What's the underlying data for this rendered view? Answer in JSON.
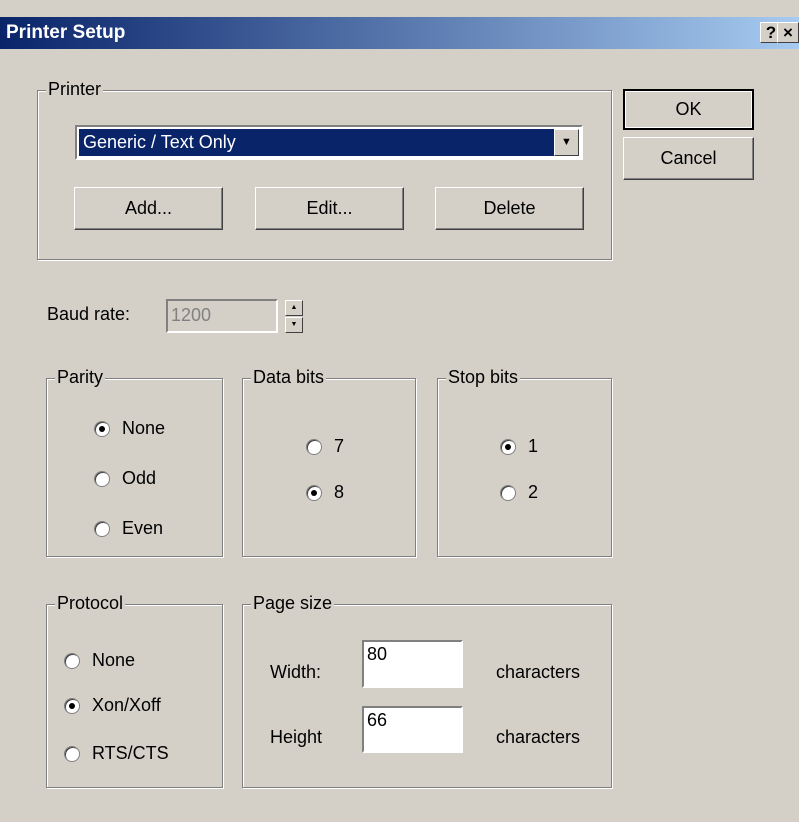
{
  "window": {
    "title": "Printer Setup",
    "help_glyph": "?",
    "close_glyph": "×"
  },
  "printer_group": {
    "legend": "Printer",
    "selected_printer": "Generic / Text Only",
    "add_label": "Add...",
    "edit_label": "Edit...",
    "delete_label": "Delete"
  },
  "buttons": {
    "ok_label": "OK",
    "cancel_label": "Cancel"
  },
  "baud": {
    "label": "Baud rate:",
    "value": "1200",
    "up_glyph": "▲",
    "down_glyph": "▼"
  },
  "parity": {
    "legend": "Parity",
    "options": [
      "None",
      "Odd",
      "Even"
    ],
    "selected": "None"
  },
  "data_bits": {
    "legend": "Data bits",
    "options": [
      "7",
      "8"
    ],
    "selected": "8"
  },
  "stop_bits": {
    "legend": "Stop bits",
    "options": [
      "1",
      "2"
    ],
    "selected": "1"
  },
  "protocol": {
    "legend": "Protocol",
    "options": [
      "None",
      "Xon/Xoff",
      "RTS/CTS"
    ],
    "selected": "Xon/Xoff"
  },
  "page_size": {
    "legend": "Page size",
    "width_label": "Width:",
    "width_value": "80",
    "height_label": "Height",
    "height_value": "66",
    "unit": "characters"
  },
  "combo_arrow_glyph": "▼"
}
